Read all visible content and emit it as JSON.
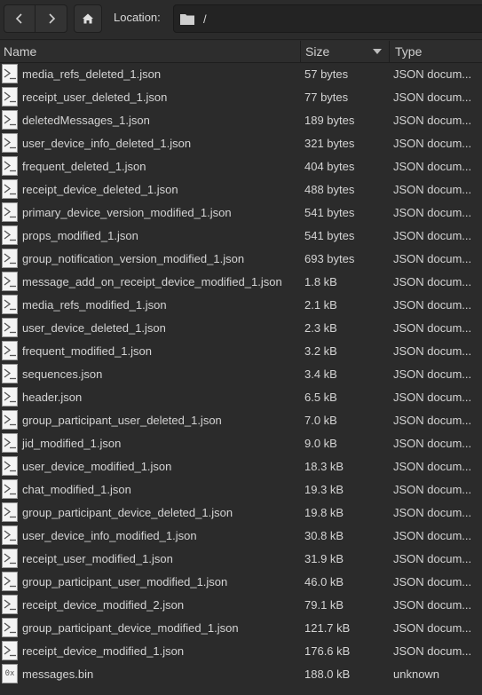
{
  "toolbar": {
    "back_icon": "chevron-left-icon",
    "forward_icon": "chevron-right-icon",
    "home_icon": "home-icon",
    "location_label": "Location:",
    "location_path": "/"
  },
  "columns": {
    "name": "Name",
    "size": "Size",
    "type": "Type"
  },
  "files": [
    {
      "name": "media_refs_deleted_1.json",
      "size": "57 bytes",
      "type": "JSON docum...",
      "icon": "json-file-icon"
    },
    {
      "name": "receipt_user_deleted_1.json",
      "size": "77 bytes",
      "type": "JSON docum...",
      "icon": "json-file-icon"
    },
    {
      "name": "deletedMessages_1.json",
      "size": "189 bytes",
      "type": "JSON docum...",
      "icon": "json-file-icon"
    },
    {
      "name": "user_device_info_deleted_1.json",
      "size": "321 bytes",
      "type": "JSON docum...",
      "icon": "json-file-icon"
    },
    {
      "name": "frequent_deleted_1.json",
      "size": "404 bytes",
      "type": "JSON docum...",
      "icon": "json-file-icon"
    },
    {
      "name": "receipt_device_deleted_1.json",
      "size": "488 bytes",
      "type": "JSON docum...",
      "icon": "json-file-icon"
    },
    {
      "name": "primary_device_version_modified_1.json",
      "size": "541 bytes",
      "type": "JSON docum...",
      "icon": "json-file-icon"
    },
    {
      "name": "props_modified_1.json",
      "size": "541 bytes",
      "type": "JSON docum...",
      "icon": "json-file-icon"
    },
    {
      "name": "group_notification_version_modified_1.json",
      "size": "693 bytes",
      "type": "JSON docum...",
      "icon": "json-file-icon"
    },
    {
      "name": "message_add_on_receipt_device_modified_1.json",
      "size": "1.8 kB",
      "type": "JSON docum...",
      "icon": "json-file-icon"
    },
    {
      "name": "media_refs_modified_1.json",
      "size": "2.1 kB",
      "type": "JSON docum...",
      "icon": "json-file-icon"
    },
    {
      "name": "user_device_deleted_1.json",
      "size": "2.3 kB",
      "type": "JSON docum...",
      "icon": "json-file-icon"
    },
    {
      "name": "frequent_modified_1.json",
      "size": "3.2 kB",
      "type": "JSON docum...",
      "icon": "json-file-icon"
    },
    {
      "name": "sequences.json",
      "size": "3.4 kB",
      "type": "JSON docum...",
      "icon": "json-file-icon"
    },
    {
      "name": "header.json",
      "size": "6.5 kB",
      "type": "JSON docum...",
      "icon": "json-file-icon"
    },
    {
      "name": "group_participant_user_deleted_1.json",
      "size": "7.0 kB",
      "type": "JSON docum...",
      "icon": "json-file-icon"
    },
    {
      "name": "jid_modified_1.json",
      "size": "9.0 kB",
      "type": "JSON docum...",
      "icon": "json-file-icon"
    },
    {
      "name": "user_device_modified_1.json",
      "size": "18.3 kB",
      "type": "JSON docum...",
      "icon": "json-file-icon"
    },
    {
      "name": "chat_modified_1.json",
      "size": "19.3 kB",
      "type": "JSON docum...",
      "icon": "json-file-icon"
    },
    {
      "name": "group_participant_device_deleted_1.json",
      "size": "19.8 kB",
      "type": "JSON docum...",
      "icon": "json-file-icon"
    },
    {
      "name": "user_device_info_modified_1.json",
      "size": "30.8 kB",
      "type": "JSON docum...",
      "icon": "json-file-icon"
    },
    {
      "name": "receipt_user_modified_1.json",
      "size": "31.9 kB",
      "type": "JSON docum...",
      "icon": "json-file-icon"
    },
    {
      "name": "group_participant_user_modified_1.json",
      "size": "46.0 kB",
      "type": "JSON docum...",
      "icon": "json-file-icon"
    },
    {
      "name": "receipt_device_modified_2.json",
      "size": "79.1 kB",
      "type": "JSON docum...",
      "icon": "json-file-icon"
    },
    {
      "name": "group_participant_device_modified_1.json",
      "size": "121.7 kB",
      "type": "JSON docum...",
      "icon": "json-file-icon"
    },
    {
      "name": "receipt_device_modified_1.json",
      "size": "176.6 kB",
      "type": "JSON docum...",
      "icon": "json-file-icon"
    },
    {
      "name": "messages.bin",
      "size": "188.0 kB",
      "type": "unknown",
      "icon": "binary-file-icon",
      "icon_text": "0x"
    }
  ]
}
